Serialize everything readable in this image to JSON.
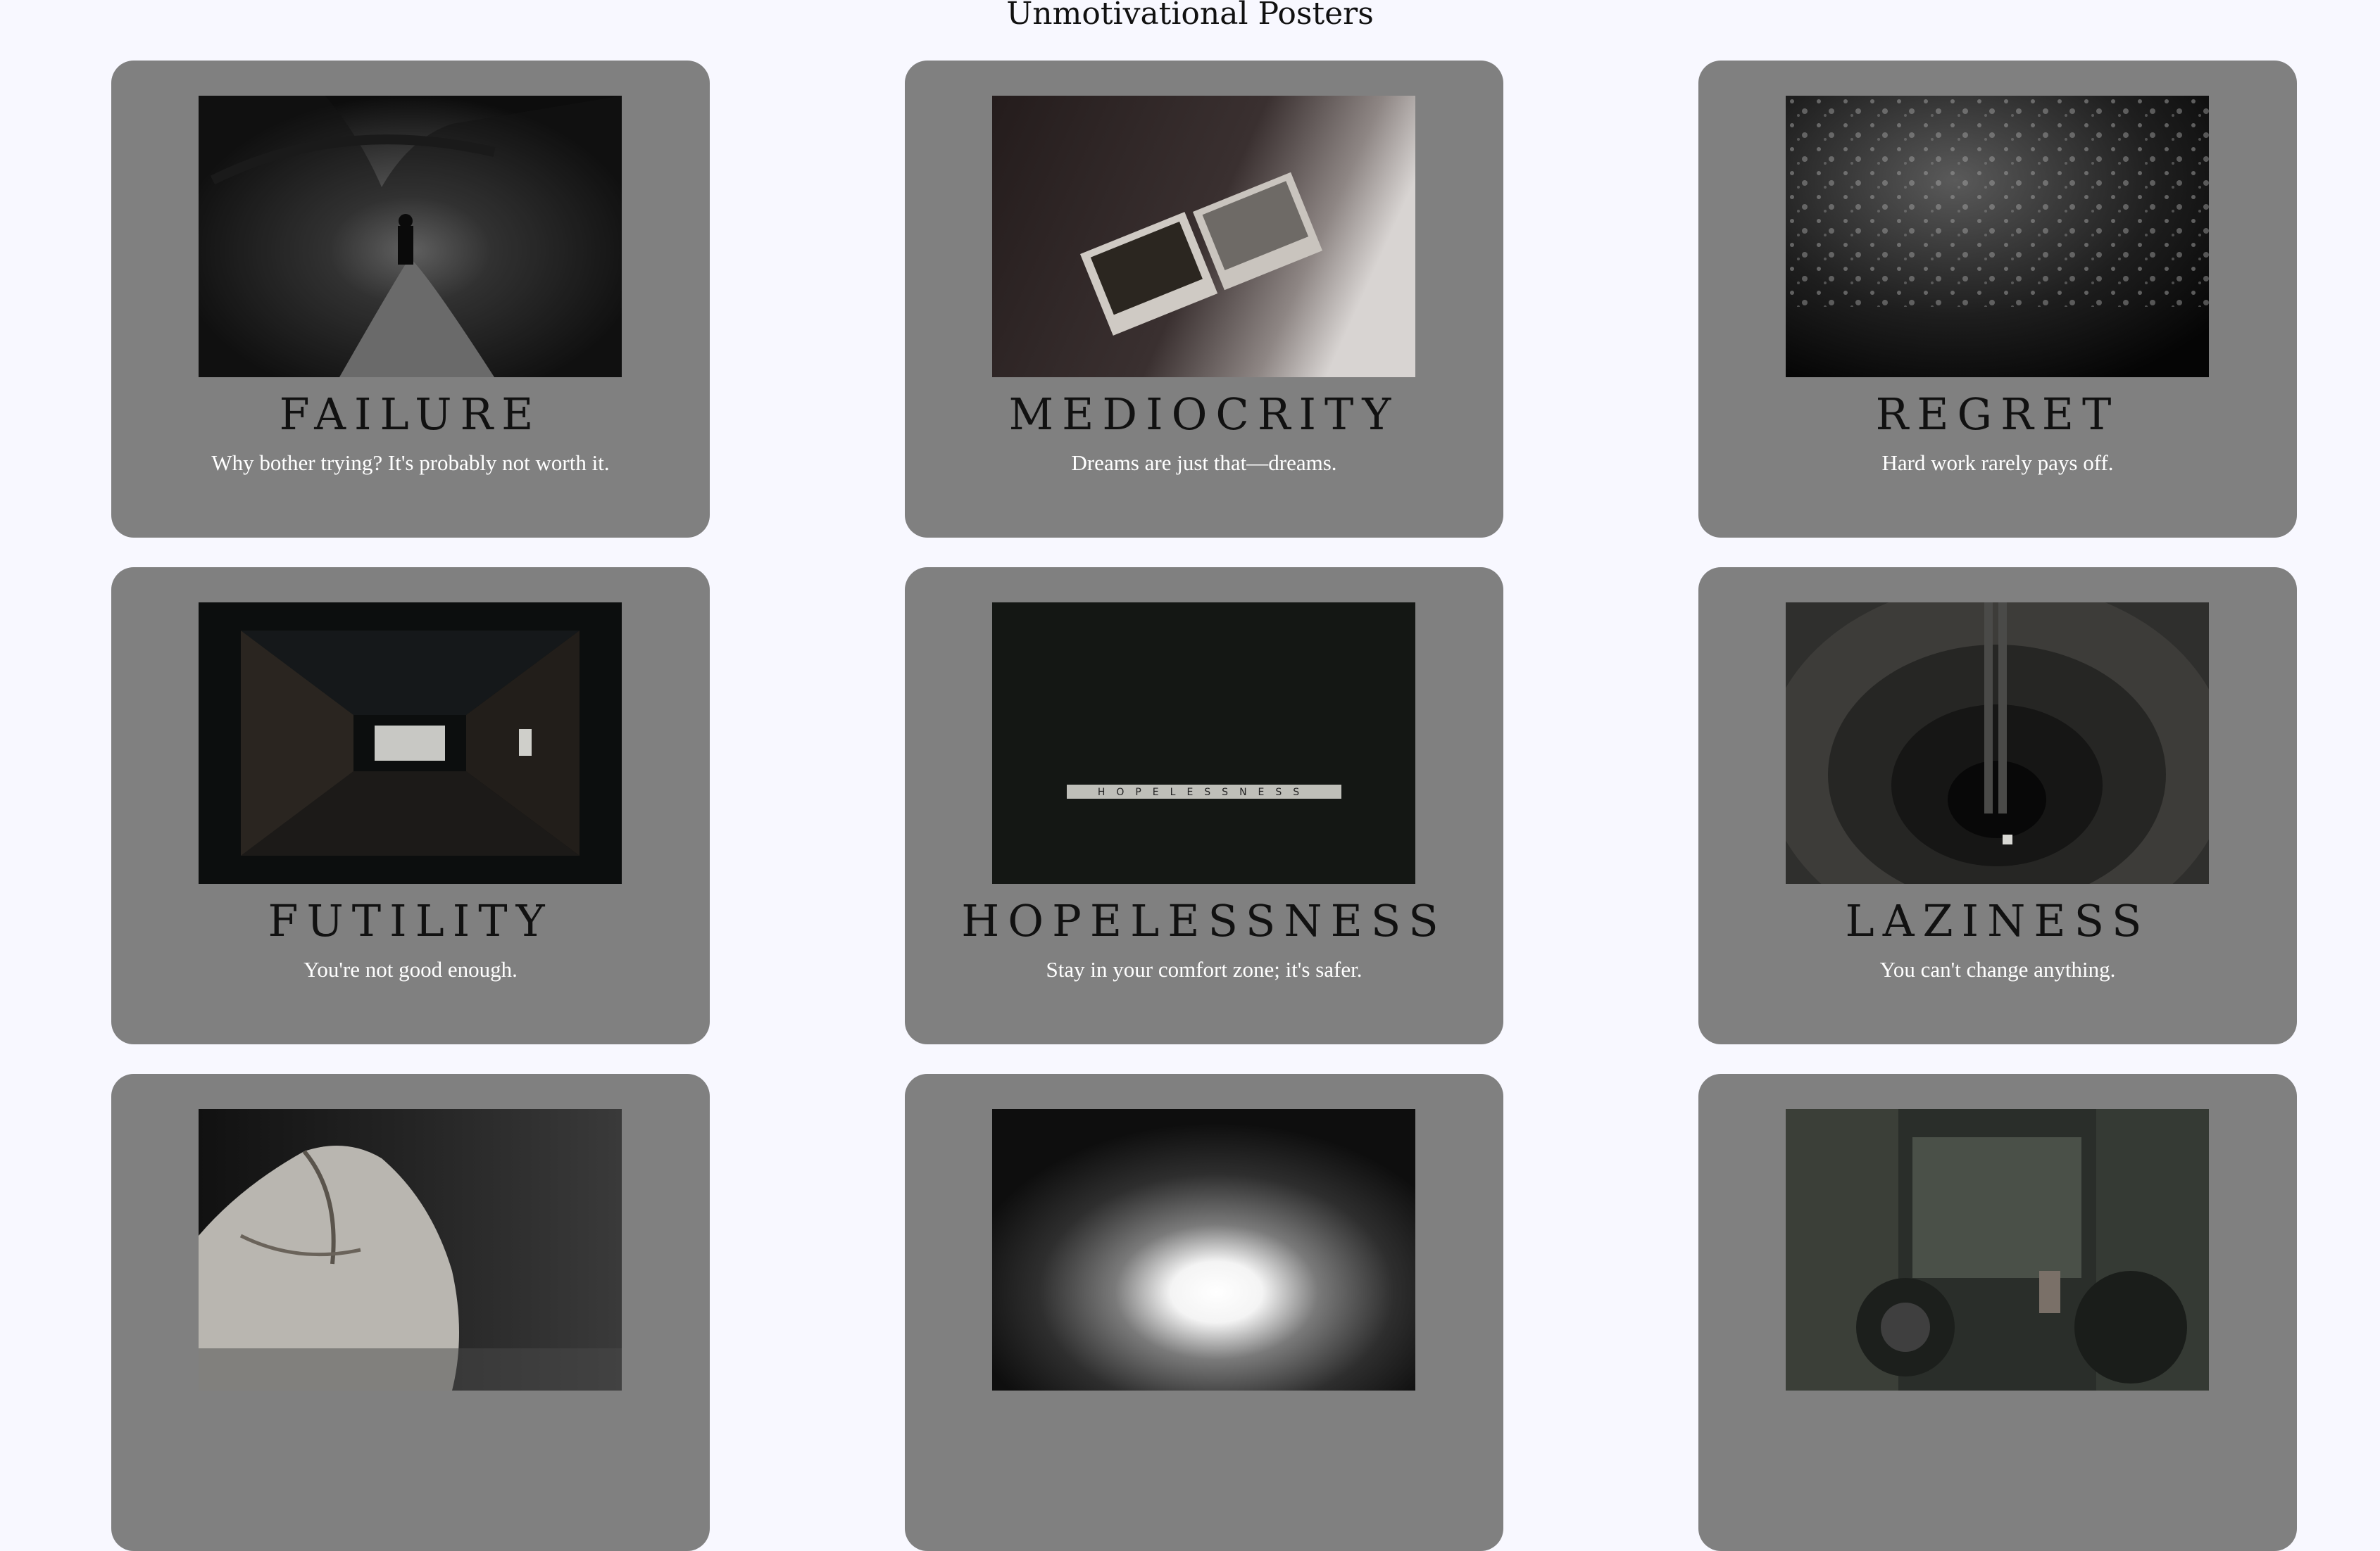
{
  "page": {
    "title": "Unmotivational Posters"
  },
  "posters": [
    {
      "title": "FAILURE",
      "caption": "Why bother trying? It's probably not worth it.",
      "image": "dark-forest-path-photo"
    },
    {
      "title": "MEDIOCRITY",
      "caption": "Dreams are just that—dreams.",
      "image": "polaroids-photo"
    },
    {
      "title": "REGRET",
      "caption": "Hard work rarely pays off.",
      "image": "raindrops-on-glass-photo"
    },
    {
      "title": "FUTILITY",
      "caption": "You're not good enough.",
      "image": "dark-hallway-photo"
    },
    {
      "title": "HOPELESSNESS",
      "caption": "Stay in your comfort zone; it's safer.",
      "image": "scrabble-tiles-photo",
      "image_text": "HOPELESSNESS"
    },
    {
      "title": "LAZINESS",
      "caption": "You can't change anything.",
      "image": "industrial-pit-photo"
    },
    {
      "title": "",
      "caption": "",
      "image": "broken-pottery-photo"
    },
    {
      "title": "",
      "caption": "",
      "image": "tunnel-light-photo"
    },
    {
      "title": "",
      "caption": "",
      "image": "abandoned-factory-photo"
    }
  ]
}
